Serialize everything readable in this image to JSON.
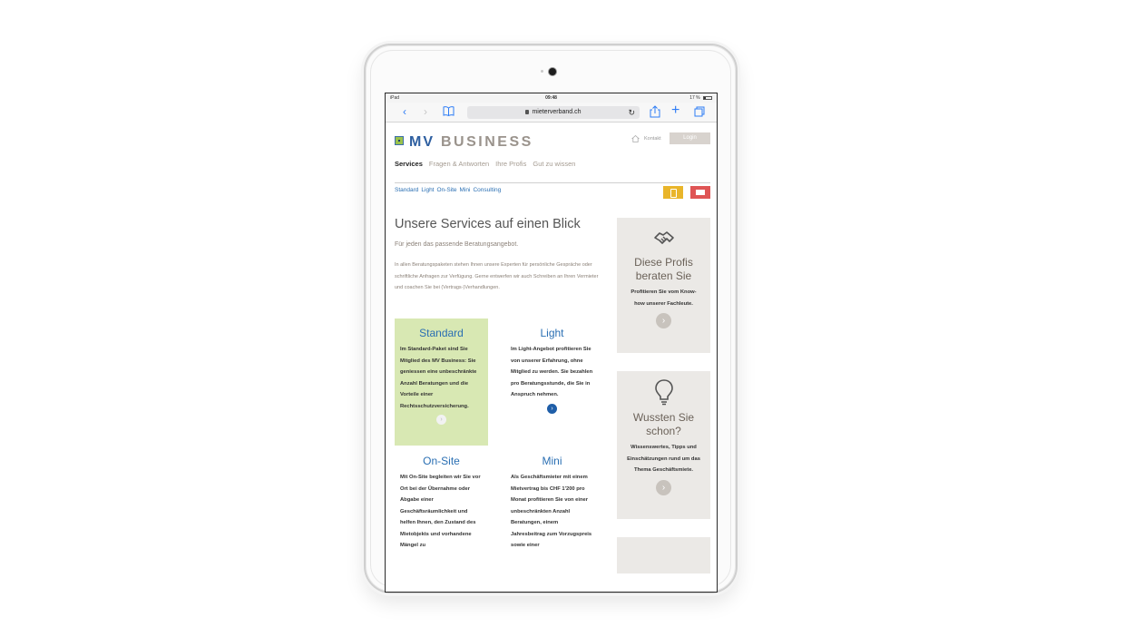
{
  "statusbar": {
    "device": "iPad",
    "time": "09:48",
    "battery": "17 %"
  },
  "browser": {
    "url": "mieterverband.ch"
  },
  "header": {
    "logo_mv": "MV",
    "logo_business": "BUSINESS",
    "kontakt": "Kontakt",
    "login": "Login"
  },
  "mainnav": [
    "Services",
    "Fragen & Antworten",
    "Ihre Profis",
    "Gut zu wissen"
  ],
  "subnav": [
    "Standard",
    "Light",
    "On-Site",
    "Mini",
    "Consulting"
  ],
  "content": {
    "headline": "Unsere Services auf einen Blick",
    "subline": "Für jeden das passende Beratungsangebot.",
    "intro": "In allen Beratungspaketen stehen Ihnen unsere Experten für persönliche Gespräche oder schriftliche Anfragen zur Verfügung. Gerne entwerfen wir auch Schreiben an Ihren Vermieter und coachen Sie bei (Vertrags-)Verhandlungen."
  },
  "packages": [
    {
      "title": "Standard",
      "text": "Im Standard-Paket sind Sie Mitglied des MV Business: Sie geniessen eine unbeschränkte Anzahl Beratungen und die Vorteile einer Rechtsschutzversicherung."
    },
    {
      "title": "Light",
      "text": "Im Light-Angebot profitieren Sie von unserer Erfahrung, ohne Mitglied zu werden. Sie bezahlen pro Beratungsstunde, die Sie in Anspruch nehmen."
    },
    {
      "title": "On-Site",
      "text": "Mit On-Site begleiten wir Sie vor Ort bei der Übernahme oder Abgabe einer Geschäftsräumlichkeit und helfen Ihnen, den Zustand des Mietobjekts und vorhandene Mängel zu"
    },
    {
      "title": "Mini",
      "text": "Als Geschäftsmieter mit einem Mietvertrag bis CHF 1'200 pro Monat profitieren Sie von einer unbeschränkten Anzahl Beratungen, einem Jahresbeitrag zum Vorzugspreis sowie einer"
    }
  ],
  "sidebar": [
    {
      "title": "Diese Profis beraten Sie",
      "text": "Profitieren Sie vom Know-how unserer Fachleute.",
      "icon": "handshake-icon"
    },
    {
      "title": "Wussten Sie schon?",
      "text": "Wissenswertes, Tipps und Einschätzungen rund um das Thema Geschäftsmiete.",
      "icon": "lightbulb-icon"
    }
  ],
  "colors": {
    "link_blue": "#2a6fb3",
    "standard_green": "#d8e8b3",
    "phone_yellow": "#e9b52a",
    "mail_red": "#df5555",
    "side_grey": "#ebe9e6"
  }
}
